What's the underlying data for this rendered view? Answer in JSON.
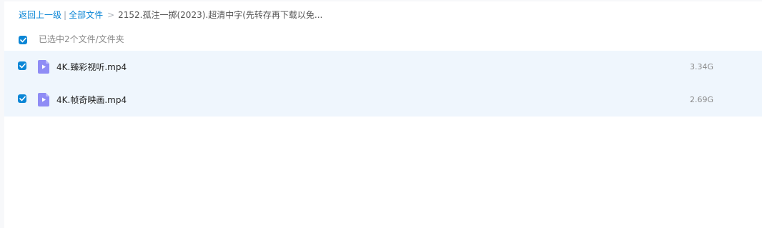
{
  "breadcrumb": {
    "back_label": "返回上一级",
    "separator": "|",
    "all_files_label": "全部文件",
    "arrow": ">",
    "current_folder": "2152.孤注一掷(2023).超清中字(先转存再下载以免..."
  },
  "selection": {
    "summary": "已选中2个文件/文件夹",
    "checked": true
  },
  "files": [
    {
      "name": "4K.臻彩视听.mp4",
      "size": "3.34G",
      "checked": true,
      "icon": "video-file-icon"
    },
    {
      "name": "4K.帧奇映画.mp4",
      "size": "2.69G",
      "checked": true,
      "icon": "video-file-icon"
    }
  ],
  "colors": {
    "accent": "#0b86d6",
    "row_selected_bg": "#eff6fd",
    "video_icon": "#8f8cf5"
  }
}
